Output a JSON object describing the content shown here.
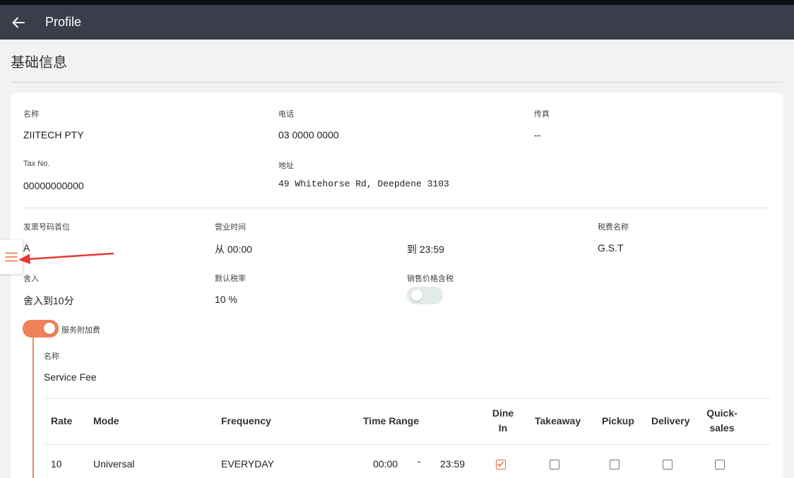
{
  "appbar": {
    "title": "Profile",
    "back_icon": "arrow-left-icon"
  },
  "section": {
    "title": "基础信息"
  },
  "company": {
    "name_label": "名称",
    "name_value": "ZIITECH PTY",
    "phone_label": "电话",
    "phone_value": "03 0000 0000",
    "fax_label": "传真",
    "fax_value": "--",
    "tax_label": "Tax No.",
    "tax_value": "00000000000",
    "address_label": "地址",
    "address_value": "49 Whitehorse Rd, Deepdene 3103"
  },
  "settings": {
    "invoice_prefix_label": "发票号码首位",
    "invoice_prefix_value": "A",
    "hours_label": "营业时间",
    "hours_from": "从 00:00",
    "hours_to": "到 23:59",
    "tax_name_label": "税费名称",
    "tax_name_value": "G.S.T",
    "rounding_label": "舍入",
    "rounding_value": "舍入到10分",
    "default_tax_label": "默认税率",
    "default_tax_value": "10 %",
    "price_incl_tax_label": "销售价格含税",
    "price_incl_tax_on": false
  },
  "service_fee": {
    "toggle_label": "服务附加费",
    "enabled": true,
    "name_label": "名称",
    "name_value": "Service Fee",
    "columns": {
      "rate": "Rate",
      "mode": "Mode",
      "frequency": "Frequency",
      "time_range": "Time Range",
      "dine_in_1": "Dine",
      "dine_in_2": "In",
      "takeaway": "Takeaway",
      "pickup": "Pickup",
      "delivery": "Delivery",
      "quick_1": "Quick-",
      "quick_2": "sales"
    },
    "rows": [
      {
        "rate": "10",
        "mode": "Universal",
        "frequency": "EVERYDAY",
        "time_from": "00:00",
        "dash": "-",
        "time_to": "23:59",
        "dine_in": true,
        "takeaway": false,
        "pickup": false,
        "delivery": false,
        "quick_sales": false
      }
    ]
  },
  "colors": {
    "appbar": "#3a3e4a",
    "accent": "#f0825a",
    "arrow": "#e53935",
    "menu_icon": "#f0825a"
  },
  "side_tab": {
    "icon": "hamburger-menu-icon"
  }
}
